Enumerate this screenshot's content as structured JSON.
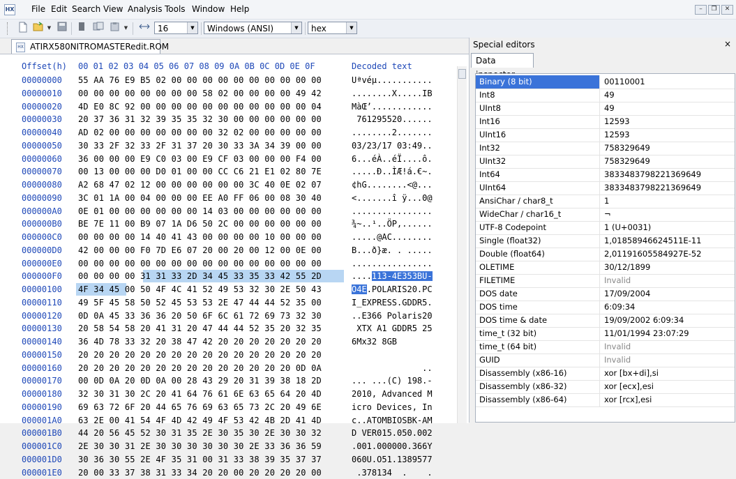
{
  "menu": [
    "File",
    "Edit",
    "Search",
    "View",
    "Analysis",
    "Tools",
    "Window",
    "Help"
  ],
  "toolbar": {
    "bytes_per_row": "16",
    "encoding": "Windows (ANSI)",
    "display_mode": "hex"
  },
  "document_tab": "ATIRX580NITROMASTERedit.ROM",
  "hex_header": {
    "offset_label": "Offset(h)",
    "columns": "00 01 02 03 04 05 06 07 08 09 0A 0B 0C 0D 0E 0F",
    "decoded_label": "Decoded text"
  },
  "rows": [
    {
      "offset": "00000000",
      "hex": "55 AA 76 E9 B5 02 00 00 00 00 00 00 00 00 00 00",
      "text": "Uªvéµ..........."
    },
    {
      "offset": "00000010",
      "hex": "00 00 00 00 00 00 00 00 58 02 00 00 00 00 49 42",
      "text": "........X.....IB"
    },
    {
      "offset": "00000020",
      "hex": "4D E0 8C 92 00 00 00 00 00 00 00 00 00 00 00 04",
      "text": "MàŒ’............"
    },
    {
      "offset": "00000030",
      "hex": "20 37 36 31 32 39 35 35 32 30 00 00 00 00 00 00",
      "text": " 761295520......"
    },
    {
      "offset": "00000040",
      "hex": "AD 02 00 00 00 00 00 00 00 32 02 00 00 00 00 00",
      "text": "........2......."
    },
    {
      "offset": "00000050",
      "hex": "30 33 2F 32 33 2F 31 37 20 30 33 3A 34 39 00 00",
      "text": "03/23/17 03:49.."
    },
    {
      "offset": "00000060",
      "hex": "36 00 00 00 E9 C0 03 00 E9 CF 03 00 00 00 F4 00",
      "text": "6...éÀ..éÏ....ô."
    },
    {
      "offset": "00000070",
      "hex": "00 13 00 00 00 D0 01 00 00 CC C6 21 E1 02 80 7E",
      "text": ".....Ð..ÌÆ!á.€~."
    },
    {
      "offset": "00000080",
      "hex": "A2 68 47 02 12 00 00 00 00 00 00 3C 40 0E 02 07",
      "text": "¢hG........<@..."
    },
    {
      "offset": "00000090",
      "hex": "3C 01 1A 00 04 00 00 00 EE A0 FF 06 00 08 30 40",
      "text": "<.......î ÿ...0@"
    },
    {
      "offset": "000000A0",
      "hex": "0E 01 00 00 00 00 00 00 14 03 00 00 00 00 00 00",
      "text": "................"
    },
    {
      "offset": "000000B0",
      "hex": "BE 7E 11 00 B9 07 1A D6 50 2C 00 00 00 00 00 00",
      "text": "¾~..¹..ÖP,......"
    },
    {
      "offset": "000000C0",
      "hex": "00 00 00 00 14 40 41 43 00 00 00 00 10 00 00 00",
      "text": ".....@AC........"
    },
    {
      "offset": "000000D0",
      "hex": "42 00 00 00 F0 7D E6 07 20 00 20 00 12 00 0E 00",
      "text": "B...ð}æ. . ....."
    },
    {
      "offset": "000000E0",
      "hex": "00 00 00 00 00 00 00 00 00 00 00 00 00 00 00 00",
      "text": "................"
    },
    {
      "offset": "000000F0",
      "hex": "00 00 00 00 31 31 33 2D 34 45 33 35 33 42 55 2D",
      "text": "....113-4E353BU-"
    },
    {
      "offset": "00000100",
      "hex": "4F 34 45 00 50 4F 4C 41 52 49 53 32 30 2E 50 43",
      "text": "O4E.POLARIS20.PC"
    },
    {
      "offset": "00000110",
      "hex": "49 5F 45 58 50 52 45 53 53 2E 47 44 44 52 35 00",
      "text": "I_EXPRESS.GDDR5."
    },
    {
      "offset": "00000120",
      "hex": "0D 0A 45 33 36 36 20 50 6F 6C 61 72 69 73 32 30",
      "text": "..E366 Polaris20"
    },
    {
      "offset": "00000130",
      "hex": "20 58 54 58 20 41 31 20 47 44 44 52 35 20 32 35",
      "text": " XTX A1 GDDR5 25"
    },
    {
      "offset": "00000140",
      "hex": "36 4D 78 33 32 20 38 47 42 20 20 20 20 20 20 20",
      "text": "6Mx32 8GB       "
    },
    {
      "offset": "00000150",
      "hex": "20 20 20 20 20 20 20 20 20 20 20 20 20 20 20 20",
      "text": "                "
    },
    {
      "offset": "00000160",
      "hex": "20 20 20 20 20 20 20 20 20 20 20 20 20 20 0D 0A",
      "text": "              .."
    },
    {
      "offset": "00000170",
      "hex": "00 0D 0A 20 0D 0A 00 28 43 29 20 31 39 38 18 2D",
      "text": "... ...(C) 198.-"
    },
    {
      "offset": "00000180",
      "hex": "32 30 31 30 2C 20 41 64 76 61 6E 63 65 64 20 4D",
      "text": "2010, Advanced M"
    },
    {
      "offset": "00000190",
      "hex": "69 63 72 6F 20 44 65 76 69 63 65 73 2C 20 49 6E",
      "text": "icro Devices, In"
    },
    {
      "offset": "000001A0",
      "hex": "63 2E 00 41 54 4F 4D 42 49 4F 53 42 4B 2D 41 4D",
      "text": "c..ATOMBIOSBK-AM"
    },
    {
      "offset": "000001B0",
      "hex": "44 20 56 45 52 30 31 35 2E 30 35 30 2E 30 30 32",
      "text": "D VER015.050.002"
    },
    {
      "offset": "000001C0",
      "hex": "2E 30 30 31 2E 30 30 30 30 30 30 2E 33 36 36 59",
      "text": ".001.000000.366Y"
    },
    {
      "offset": "000001D0",
      "hex": "30 36 30 55 2E 4F 35 31 00 31 33 38 39 35 37 37",
      "text": "060U.O51.1389577"
    },
    {
      "offset": "000001E0",
      "hex": "20 00 33 37 38 31 33 34 20 20 00 20 20 20 20 00",
      "text": " .378134  .    ."
    }
  ],
  "special_editors": {
    "title": "Special editors",
    "close": "×",
    "tab": "Data inspector",
    "rows": [
      {
        "name": "Binary (8 bit)",
        "value": "00110001",
        "selected": true
      },
      {
        "name": "Int8",
        "value": "49"
      },
      {
        "name": "UInt8",
        "value": "49"
      },
      {
        "name": "Int16",
        "value": "12593"
      },
      {
        "name": "UInt16",
        "value": "12593"
      },
      {
        "name": "Int32",
        "value": "758329649"
      },
      {
        "name": "UInt32",
        "value": "758329649"
      },
      {
        "name": "Int64",
        "value": "3833483798221369649"
      },
      {
        "name": "UInt64",
        "value": "3833483798221369649"
      },
      {
        "name": "AnsiChar / char8_t",
        "value": "1"
      },
      {
        "name": "WideChar / char16_t",
        "value": "¬"
      },
      {
        "name": "UTF-8 Codepoint",
        "value": "1 (U+0031)"
      },
      {
        "name": "Single (float32)",
        "value": "1,01858946624511E-11"
      },
      {
        "name": "Double (float64)",
        "value": "2,01191605584927E-52"
      },
      {
        "name": "OLETIME",
        "value": "30/12/1899"
      },
      {
        "name": "FILETIME",
        "value": "Invalid",
        "invalid": true
      },
      {
        "name": "DOS date",
        "value": "17/09/2004"
      },
      {
        "name": "DOS time",
        "value": "6:09:34"
      },
      {
        "name": "DOS time & date",
        "value": "19/09/2002 6:09:34"
      },
      {
        "name": "time_t (32 bit)",
        "value": "11/01/1994 23:07:29"
      },
      {
        "name": "time_t (64 bit)",
        "value": "Invalid",
        "invalid": true
      },
      {
        "name": "GUID",
        "value": "Invalid",
        "invalid": true
      },
      {
        "name": "Disassembly (x86-16)",
        "value": "xor [bx+di],si"
      },
      {
        "name": "Disassembly (x86-32)",
        "value": "xor [ecx],esi"
      },
      {
        "name": "Disassembly (x86-64)",
        "value": "xor [rcx],esi"
      }
    ]
  }
}
